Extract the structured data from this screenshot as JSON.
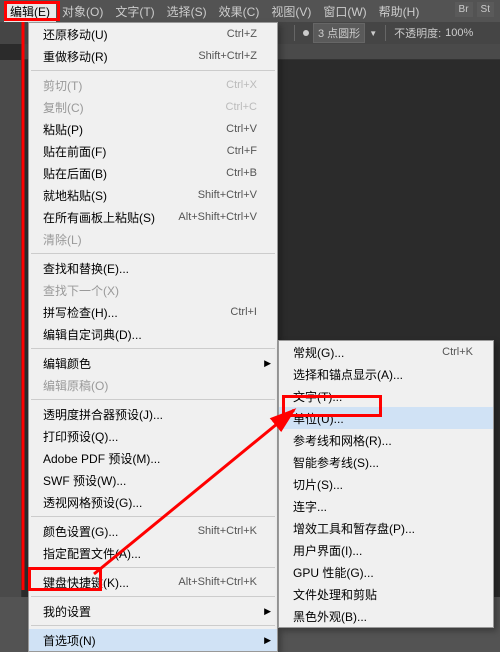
{
  "menubar": {
    "items": [
      {
        "label": "编辑(E)",
        "active": true
      },
      {
        "label": "对象(O)"
      },
      {
        "label": "文字(T)"
      },
      {
        "label": "选择(S)"
      },
      {
        "label": "效果(C)"
      },
      {
        "label": "视图(V)"
      },
      {
        "label": "窗口(W)"
      },
      {
        "label": "帮助(H)"
      }
    ],
    "badges": [
      "Br",
      "St"
    ]
  },
  "toolbar": {
    "stroke_value": "3 点圆形",
    "opacity_label": "不透明度:",
    "opacity_value": "100%"
  },
  "menu_main": [
    {
      "label": "还原移动(U)",
      "shortcut": "Ctrl+Z"
    },
    {
      "label": "重做移动(R)",
      "shortcut": "Shift+Ctrl+Z"
    },
    {
      "sep": true
    },
    {
      "label": "剪切(T)",
      "shortcut": "Ctrl+X",
      "disabled": true
    },
    {
      "label": "复制(C)",
      "shortcut": "Ctrl+C",
      "disabled": true
    },
    {
      "label": "粘贴(P)",
      "shortcut": "Ctrl+V"
    },
    {
      "label": "贴在前面(F)",
      "shortcut": "Ctrl+F"
    },
    {
      "label": "贴在后面(B)",
      "shortcut": "Ctrl+B"
    },
    {
      "label": "就地粘贴(S)",
      "shortcut": "Shift+Ctrl+V"
    },
    {
      "label": "在所有画板上粘贴(S)",
      "shortcut": "Alt+Shift+Ctrl+V"
    },
    {
      "label": "清除(L)",
      "disabled": true
    },
    {
      "sep": true
    },
    {
      "label": "查找和替换(E)..."
    },
    {
      "label": "查找下一个(X)",
      "disabled": true
    },
    {
      "label": "拼写检查(H)...",
      "shortcut": "Ctrl+I"
    },
    {
      "label": "编辑自定词典(D)..."
    },
    {
      "sep": true
    },
    {
      "label": "编辑颜色",
      "arrow": true
    },
    {
      "label": "编辑原稿(O)",
      "disabled": true
    },
    {
      "sep": true
    },
    {
      "label": "透明度拼合器预设(J)..."
    },
    {
      "label": "打印预设(Q)..."
    },
    {
      "label": "Adobe PDF 预设(M)..."
    },
    {
      "label": "SWF 预设(W)..."
    },
    {
      "label": "透视网格预设(G)..."
    },
    {
      "sep": true
    },
    {
      "label": "颜色设置(G)...",
      "shortcut": "Shift+Ctrl+K"
    },
    {
      "label": "指定配置文件(A)..."
    },
    {
      "sep": true
    },
    {
      "label": "键盘快捷键(K)...",
      "shortcut": "Alt+Shift+Ctrl+K"
    },
    {
      "sep": true
    },
    {
      "label": "我的设置",
      "arrow": true
    },
    {
      "sep": true
    },
    {
      "label": "首选项(N)",
      "arrow": true,
      "hover": true
    }
  ],
  "menu_sub": [
    {
      "label": "常规(G)...",
      "shortcut": "Ctrl+K"
    },
    {
      "label": "选择和锚点显示(A)..."
    },
    {
      "label": "文字(T)..."
    },
    {
      "label": "单位(U)...",
      "hover": true
    },
    {
      "label": "参考线和网格(R)..."
    },
    {
      "label": "智能参考线(S)..."
    },
    {
      "label": "切片(S)..."
    },
    {
      "label": "连字..."
    },
    {
      "label": "增效工具和暂存盘(P)..."
    },
    {
      "label": "用户界面(I)..."
    },
    {
      "label": "GPU 性能(G)..."
    },
    {
      "label": "文件处理和剪贴"
    },
    {
      "label": "黑色外观(B)..."
    }
  ]
}
